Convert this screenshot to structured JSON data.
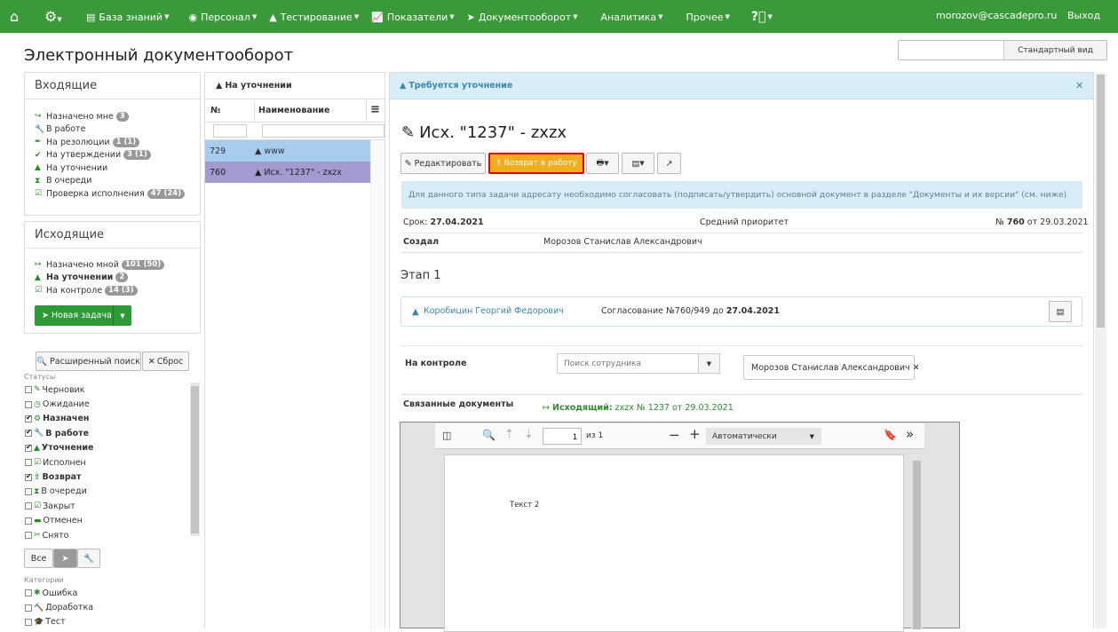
{
  "nav": {
    "items": [
      "База знаний",
      "Персонал",
      "Тестирование",
      "Показатели",
      "Документооборот",
      "Аналитика",
      "Прочее"
    ],
    "user": "morozov@cascadepro.ru",
    "logout": "Выход"
  },
  "page_title": "Электронный документооборот",
  "std_view": "Стандартный вид",
  "incoming": {
    "title": "Входящие",
    "items": [
      {
        "label": "Назначено мне",
        "badge": "3",
        "icon": "↪"
      },
      {
        "label": "В работе",
        "badge": "",
        "icon": "🔧"
      },
      {
        "label": "На резолюции",
        "badge": "1 (1)",
        "icon": "✒"
      },
      {
        "label": "На утверждении",
        "badge": "3 (1)",
        "icon": "✔"
      },
      {
        "label": "На уточнении",
        "badge": "",
        "icon": "▲"
      },
      {
        "label": "В очереди",
        "badge": "",
        "icon": "⧗"
      },
      {
        "label": "Проверка исполнения",
        "badge": "47 (24)",
        "icon": "☑"
      }
    ]
  },
  "outgoing": {
    "title": "Исходящие",
    "items": [
      {
        "label": "Назначено мной",
        "badge": "101 (50)",
        "icon": "↦"
      },
      {
        "label": "На уточнении",
        "badge": "2",
        "icon": "▲"
      },
      {
        "label": "На контроле",
        "badge": "14 (3)",
        "icon": "☑"
      }
    ],
    "new_task": "Новая задача"
  },
  "search": {
    "advanced": "Расширенный поиск",
    "reset": "Сброс"
  },
  "statuses": {
    "label": "Статусы",
    "items": [
      {
        "label": "Черновик",
        "checked": false,
        "icon": "✎"
      },
      {
        "label": "Ожидание",
        "checked": false,
        "icon": "◷"
      },
      {
        "label": "Назначен",
        "checked": true,
        "icon": "⚙"
      },
      {
        "label": "В работе",
        "checked": true,
        "icon": "🔧"
      },
      {
        "label": "Уточнение",
        "checked": true,
        "icon": "▲"
      },
      {
        "label": "Исполнен",
        "checked": false,
        "icon": "☑"
      },
      {
        "label": "Возврат",
        "checked": true,
        "icon": "⇪"
      },
      {
        "label": "В очереди",
        "checked": false,
        "icon": "⧗"
      },
      {
        "label": "Закрыт",
        "checked": false,
        "icon": "☑"
      },
      {
        "label": "Отменен",
        "checked": false,
        "icon": "▬"
      },
      {
        "label": "Снято",
        "checked": false,
        "icon": "✂"
      }
    ]
  },
  "filter_tabs": {
    "all": "Все"
  },
  "categories": {
    "label": "Категории",
    "items": [
      {
        "label": "Ошибка",
        "icon": "✱"
      },
      {
        "label": "Доработка",
        "icon": "🔨"
      },
      {
        "label": "Тест",
        "icon": "🎓"
      }
    ]
  },
  "list": {
    "title": "На уточнении",
    "col_no": "№",
    "col_name": "Наименование",
    "rows": [
      {
        "no": "729",
        "name": "www"
      },
      {
        "no": "760",
        "name": "Исх. \"1237\" - zxzx"
      }
    ]
  },
  "detail": {
    "header": "Требуется уточнение",
    "doc_title": "Исх. \"1237\" - zxzx",
    "edit": "Редактировать",
    "return": "Возврат в работу",
    "info": "Для данного типа задачи адресату необходимо согласовать (подписать/утвердить) основной документ в разделе \"Документы и их версии\" (см. ниже)",
    "deadline_label": "Срок:",
    "deadline": "27.04.2021",
    "priority": "Средний приоритет",
    "num_prefix": "№",
    "num": "760",
    "num_date": "от 29.03.2021",
    "author_label": "Создал",
    "author": "Морозов Станислав Александрович",
    "stage": "Этап 1",
    "stage_person": "Коробицин Георгий Федорович",
    "approval": "Согласование №760/949 до",
    "approval_date": "27.04.2021",
    "control_label": "На контроле",
    "search_placeholder": "Поиск сотрудника",
    "control_person": "Морозов Станислав Александрович",
    "related_label": "Связанные документы",
    "related_prefix": "Исходящий:",
    "related_doc": "zxzx № 1237 от 29.03.2021"
  },
  "pdf": {
    "page": "1",
    "of": "из 1",
    "zoom": "Автоматически",
    "text": "Текст 2"
  },
  "colors": {
    "nav": "#3a9a3a",
    "accent_btn": "#f0ad1e",
    "highlight": "#e00000",
    "row_selected": "#a59ad0",
    "row_blue": "#a8cbf0"
  }
}
